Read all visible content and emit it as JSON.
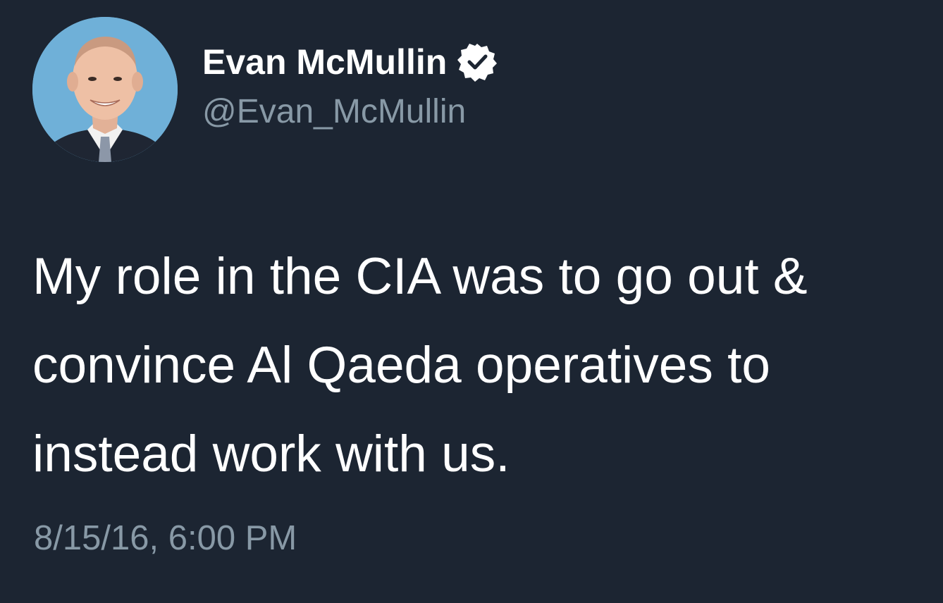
{
  "tweet": {
    "author": {
      "display_name": "Evan McMullin",
      "handle": "@Evan_McMullin",
      "verified": true,
      "avatar_icon": "profile-photo"
    },
    "text_lines": [
      "My role in the CIA was to go out &",
      "convince Al Qaeda operatives to",
      "instead work with us."
    ],
    "timestamp": "8/15/16, 6:00 PM"
  },
  "colors": {
    "background": "#1c2532",
    "primary_text": "#ffffff",
    "secondary_text": "#8899a6",
    "avatar_bg": "#6fb0d8"
  }
}
